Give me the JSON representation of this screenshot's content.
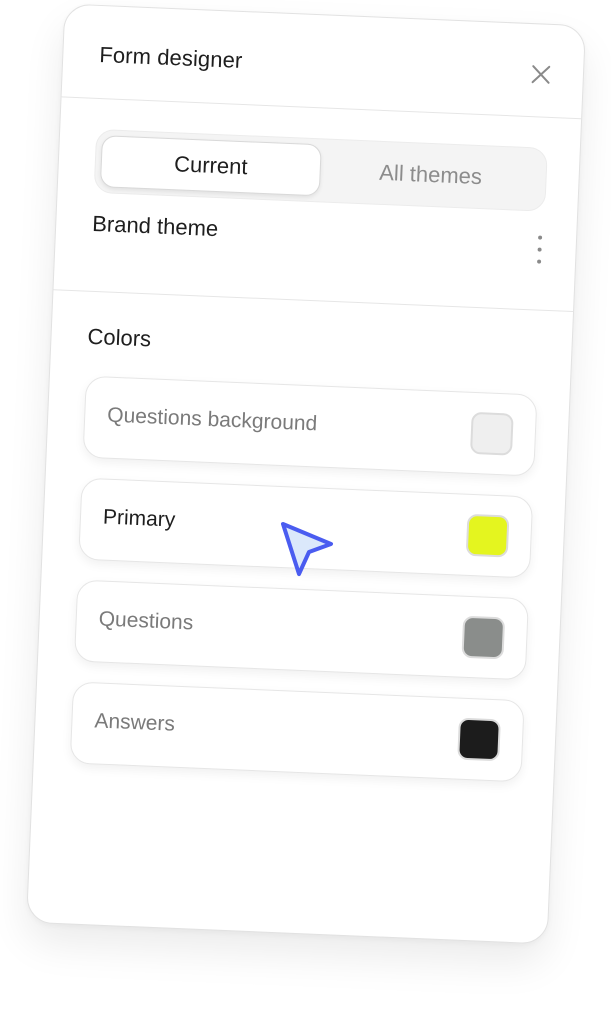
{
  "panel": {
    "title": "Form designer"
  },
  "tabs": [
    {
      "label": "Current",
      "active": true
    },
    {
      "label": "All themes",
      "active": false
    }
  ],
  "theme": {
    "name": "Brand theme"
  },
  "colors": {
    "title": "Colors",
    "items": [
      {
        "label": "Questions background",
        "color": "#efefef"
      },
      {
        "label": "Primary",
        "color": "#e4f51f"
      },
      {
        "label": "Questions",
        "color": "#8a8d8b"
      },
      {
        "label": "Answers",
        "color": "#1c1c1c"
      }
    ]
  },
  "icons": {
    "close": "close-icon",
    "more": "more-vertical-icon",
    "cursor": "pointer-cursor-icon"
  },
  "accent": "#4a5cf0"
}
